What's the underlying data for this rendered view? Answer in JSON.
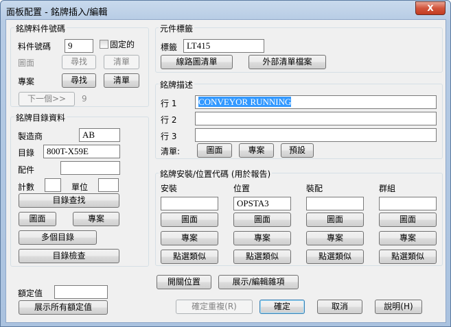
{
  "window": {
    "title": "面板配置 - 銘牌插入/編輯",
    "close_label": "X"
  },
  "part": {
    "title": "銘牌料件號碼",
    "part_no_label": "料件號碼",
    "part_no_value": "9",
    "fixed_label": "固定的",
    "drawing_label": "圖面",
    "find1": "尋找",
    "clear1": "清單",
    "project_label": "專案",
    "find2": "尋找",
    "clear2": "清單",
    "next_label": "下一個>>",
    "next_count": "9"
  },
  "catalog": {
    "title": "銘牌目錄資料",
    "mfr_label": "製造商",
    "mfr_value": "AB",
    "cat_label": "目錄",
    "cat_value": "800T-X59E",
    "acc_label": "配件",
    "acc_value": "",
    "count_label": "計數",
    "count_value": "",
    "unit_label": "單位",
    "unit_value": "",
    "lookup": "目錄查找",
    "drawing": "圖面",
    "project": "專案",
    "multi": "多個目錄",
    "check": "目錄檢查"
  },
  "rating": {
    "label": "額定值",
    "value": "",
    "show_all": "展示所有額定值"
  },
  "component": {
    "title": "元件標籤",
    "tag_label": "標籤",
    "tag_value": "LT415",
    "wire_list": "線路圖清單",
    "ext_list": "外部清單檔案"
  },
  "desc": {
    "title": "銘牌描述",
    "lines": [
      {
        "label": "行 1",
        "value": "CONVEYOR RUNNING"
      },
      {
        "label": "行 2",
        "value": ""
      },
      {
        "label": "行 3",
        "value": ""
      }
    ],
    "list_label": "清單:",
    "drawing": "圖面",
    "project": "專案",
    "default": "預設"
  },
  "install": {
    "title": "銘牌安裝/位置代碼 (用於報告)",
    "columns": [
      {
        "label": "安裝",
        "value": "",
        "drawing": "圖面",
        "project": "專案",
        "pick": "點選類似"
      },
      {
        "label": "位置",
        "value": "OPSTA3",
        "drawing": "圖面",
        "project": "專案",
        "pick": "點選類似"
      },
      {
        "label": "裝配",
        "value": "",
        "drawing": "圖面",
        "project": "專案",
        "pick": "點選類似"
      },
      {
        "label": "群組",
        "value": "",
        "drawing": "圖面",
        "project": "專案",
        "pick": "點選類似"
      }
    ]
  },
  "footer": {
    "switch_pos": "開關位置",
    "show_edit_misc": "展示/編輯雜項",
    "ok_repeat": "確定重複(R)",
    "ok": "確定",
    "cancel": "取消",
    "help": "說明(H)"
  }
}
